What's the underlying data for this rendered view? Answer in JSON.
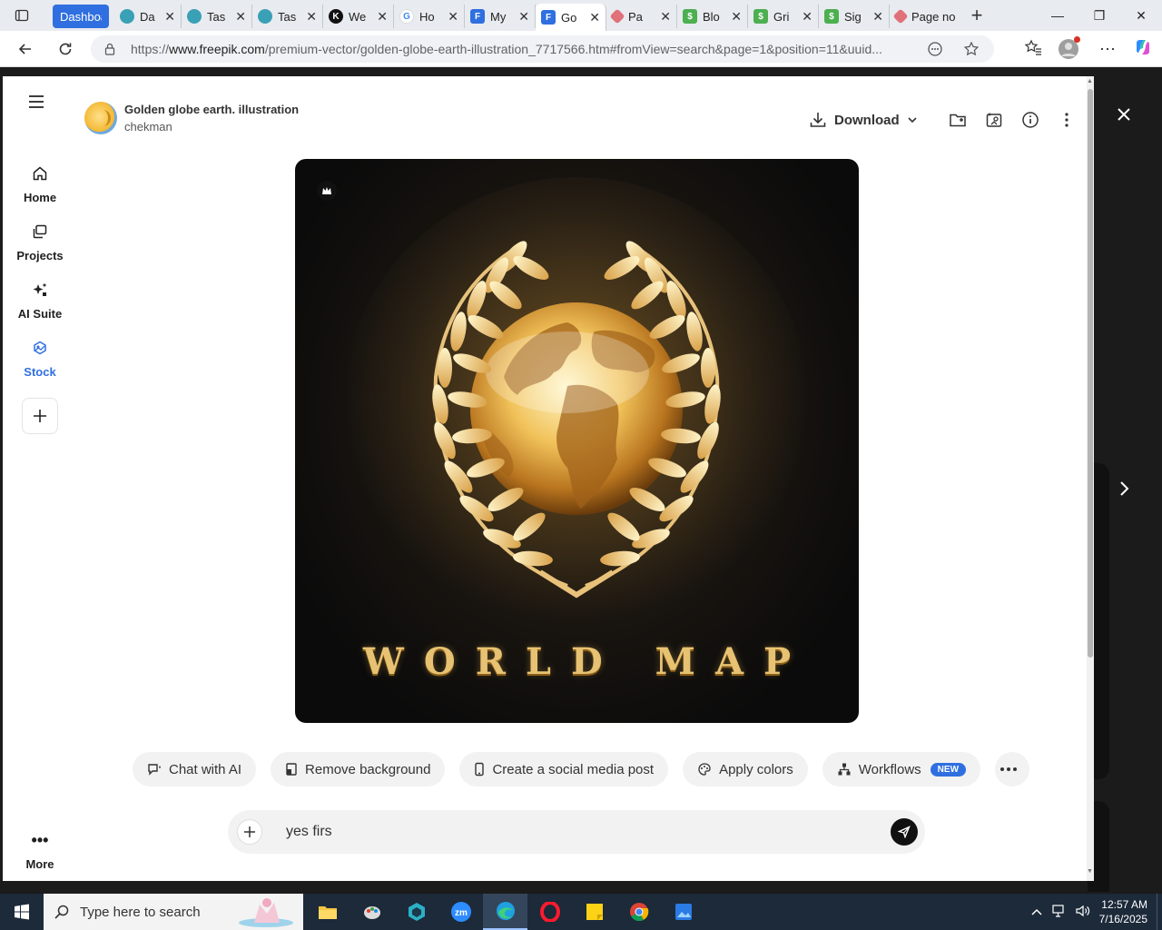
{
  "browser": {
    "tabs": [
      {
        "label": "Dashboard",
        "fav_color": "#2f6fe0"
      },
      {
        "label": "Da",
        "fav_color": "#3aa0b5"
      },
      {
        "label": "Tas",
        "fav_color": "#3aa0b5"
      },
      {
        "label": "Tas",
        "fav_color": "#3aa0b5"
      },
      {
        "label": "We",
        "fav_color": "#111111"
      },
      {
        "label": "Ho",
        "fav_color": "#ffffff"
      },
      {
        "label": "My",
        "fav_color": "#2f6fe0"
      },
      {
        "label": "Go",
        "fav_color": "#2f6fe0"
      },
      {
        "label": "Pa",
        "fav_color": "#e0707a"
      },
      {
        "label": "Blo",
        "fav_color": "#4caf50"
      },
      {
        "label": "Gri",
        "fav_color": "#4caf50"
      },
      {
        "label": "Sig",
        "fav_color": "#4caf50"
      },
      {
        "label": "Page no",
        "fav_color": "#e0707a"
      }
    ],
    "url_prefix": "https://",
    "url_domain": "www.freepik.com",
    "url_path": "/premium-vector/golden-globe-earth-illustration_7717566.htm#fromView=search&page=1&position=11&uuid..."
  },
  "sidebar": {
    "items": [
      {
        "label": "Home"
      },
      {
        "label": "Projects"
      },
      {
        "label": "AI Suite"
      },
      {
        "label": "Stock"
      }
    ],
    "more_label": "More"
  },
  "asset": {
    "title": "Golden globe earth. illustration",
    "author": "chekman",
    "image_text": "WORLD MAP"
  },
  "actions": {
    "download_label": "Download"
  },
  "chips": [
    {
      "label": "Chat with AI"
    },
    {
      "label": "Remove background"
    },
    {
      "label": "Create a social media post"
    },
    {
      "label": "Apply colors"
    },
    {
      "label": "Workflows"
    }
  ],
  "new_badge": "NEW",
  "chat": {
    "value": "yes firs"
  },
  "taskbar": {
    "search_placeholder": "Type here to search",
    "time": "12:57 AM",
    "date": "7/16/2025"
  },
  "colors": {
    "accent": "#2f6fe0",
    "gold": "#e7c272"
  }
}
